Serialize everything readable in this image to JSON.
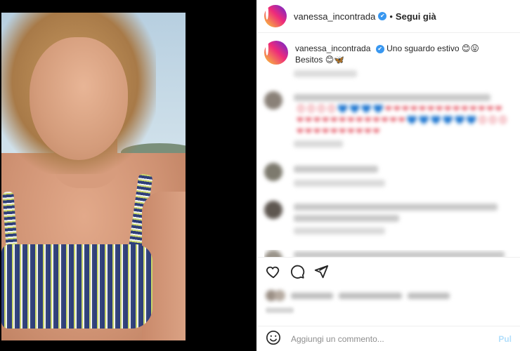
{
  "post": {
    "username": "vanessa_incontrada",
    "verified_mark": "✔",
    "separator": "•",
    "follow_label": "Segui già"
  },
  "caption": {
    "username": "vanessa_incontrada",
    "text": "Uno sguardo estivo",
    "emojis_line1": "😊😛",
    "line2": "Besitos",
    "emojis_line2": "😊🦋"
  },
  "comments": {
    "heart_rows": [
      "😊😊😊😊💙💙💙💙❤❤❤❤❤❤❤❤❤❤❤❤❤❤",
      "❤❤❤❤❤❤❤❤❤❤❤❤❤💙💙💙💙💙💙😊😊😊",
      "❤❤❤❤❤❤❤❤❤❤"
    ]
  },
  "actions": {
    "like_icon": "heart-outline-icon",
    "comment_icon": "comment-bubble-icon",
    "share_icon": "paper-plane-icon"
  },
  "composer": {
    "placeholder": "Aggiungi un commento...",
    "publish_label": "Pul"
  },
  "colors": {
    "verified": "#3897f0",
    "publish": "#b2dffc",
    "text": "#262626",
    "muted": "#8e8e8e"
  }
}
